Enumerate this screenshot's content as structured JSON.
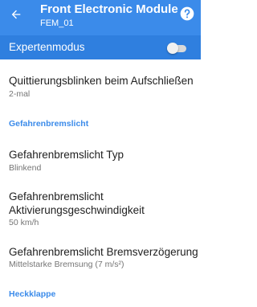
{
  "appbar": {
    "title": "Front Electronic Module",
    "subtitle": "FEM_01",
    "back_icon": "arrow-left-icon",
    "help_icon": "help-circle-icon",
    "color": "#3b8bea"
  },
  "expert_mode": {
    "label": "Expertenmodus",
    "enabled": false,
    "color": "#2f7fdf"
  },
  "items": [
    {
      "title": "Quittierungsblinken beim Aufschließen",
      "summary": "2-mal"
    },
    {
      "title": "Gefahrenbremslicht Typ",
      "summary": "Blinkend"
    },
    {
      "title": "Gefahrenbremslicht Aktivierungsgeschwindigkeit",
      "summary": "50 km/h"
    },
    {
      "title": "Gefahrenbremslicht Bremsverzögerung",
      "summary": "Mittelstarke Bremsung (7 m/s²)"
    }
  ],
  "categories": [
    {
      "label": "Gefahrenbremslicht"
    },
    {
      "label": "Heckklappe"
    }
  ],
  "accent_color": "#3b8bea"
}
